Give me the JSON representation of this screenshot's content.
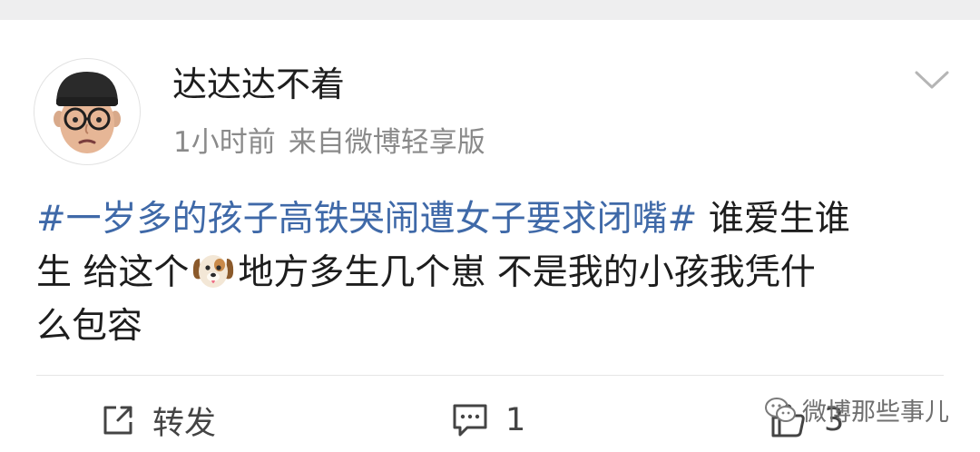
{
  "post": {
    "author": "达达达不着",
    "time": "1小时前",
    "source": "来自微博轻享版",
    "topic": "#一岁多的孩子高铁哭闹遭女子要求闭嘴#",
    "line1_rest": " 谁爱生谁",
    "line2_a": "生 给这个",
    "emoji_icon": "dog-face-icon",
    "line2_b": "地方多生几个崽 不是我的小孩我凭什",
    "line3": "么包容"
  },
  "actions": {
    "repost_label": "转发",
    "comment_count": "1",
    "like_count": "3"
  },
  "watermark": {
    "text": "微博那些事儿"
  },
  "colors": {
    "topic_blue": "#3f69a8",
    "text": "#1d1d1d",
    "meta_gray": "#8a8a8a"
  }
}
